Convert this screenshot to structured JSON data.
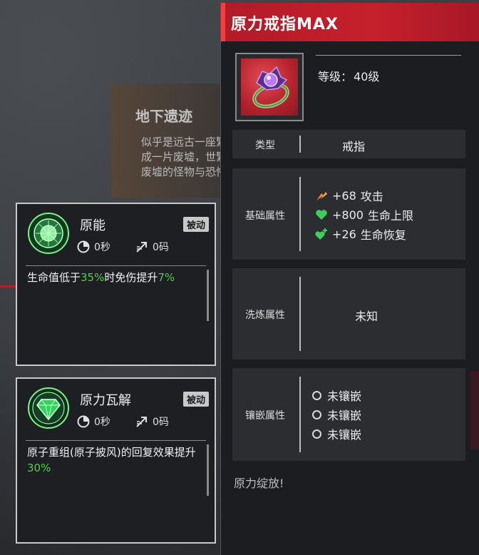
{
  "background": {
    "location_title": "地下遗迹",
    "location_desc": "似乎是远古一座繁华的城市，但如今已成一片废墟，世繁华，但如今已成一片废墟的怪物与恐怖生物"
  },
  "skills": [
    {
      "name": "原能",
      "badge": "被动",
      "cooldown": "0秒",
      "cost": "0码",
      "desc_pre": "生命值低于",
      "desc_hl1": "35%",
      "desc_mid": "时免伤提升",
      "desc_hl2": "7%",
      "icon": "green-core-icon"
    },
    {
      "name": "原力瓦解",
      "badge": "被动",
      "cooldown": "0秒",
      "cost": "0码",
      "desc_pre": "原子重组(原子披风)的回复效果提升",
      "desc_hl1": "30%",
      "icon": "green-gem-icon"
    }
  ],
  "item": {
    "title": "原力戒指MAX",
    "level_label": "等级：",
    "level_value": "40级",
    "type_label": "类型",
    "type_value": "戒指",
    "base_label": "基础属性",
    "stats": [
      {
        "value": "+68",
        "name": "攻击",
        "icon": "attack-icon",
        "color": "#f08a2a"
      },
      {
        "value": "+800",
        "name": "生命上限",
        "icon": "heart-icon",
        "color": "#3ecf5a"
      },
      {
        "value": "+26",
        "name": "生命恢复",
        "icon": "heart-plus-icon",
        "color": "#3ecf5a"
      }
    ],
    "refine_label": "洗炼属性",
    "refine_value": "未知",
    "socket_label": "镶嵌属性",
    "sockets": [
      "未镶嵌",
      "未镶嵌",
      "未镶嵌"
    ],
    "flavor": "原力绽放!"
  },
  "colors": {
    "header_red": "#c6202c",
    "highlight_green": "#4fd04f"
  }
}
